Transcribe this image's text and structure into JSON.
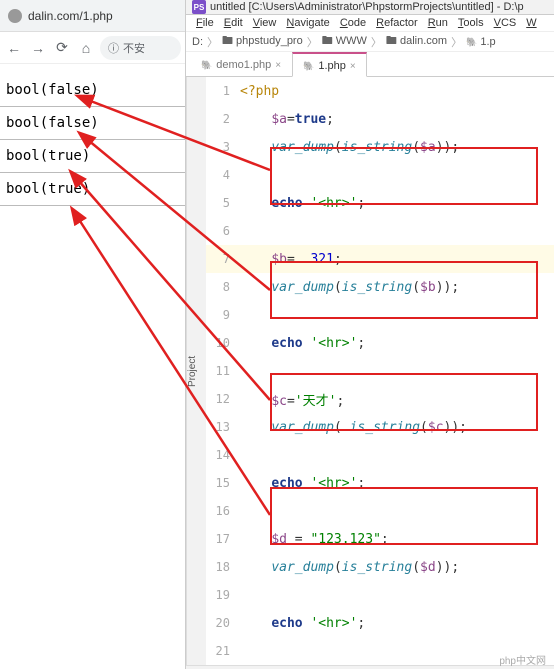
{
  "browser": {
    "tab_title": "dalin.com/1.php",
    "security_text": "不安",
    "output": [
      "bool(false)",
      "bool(false)",
      "bool(true)",
      "bool(true)"
    ]
  },
  "ide": {
    "title_text": "untitled [C:\\Users\\Administrator\\PhpstormProjects\\untitled] - D:\\p",
    "menu": [
      "File",
      "Edit",
      "View",
      "Navigate",
      "Code",
      "Refactor",
      "Run",
      "Tools",
      "VCS",
      "W"
    ],
    "breadcrumb": [
      "D:",
      "phpstudy_pro",
      "WWW",
      "dalin.com",
      "1.p"
    ],
    "tabs": [
      {
        "label": "demo1.php",
        "active": false
      },
      {
        "label": "1.php",
        "active": true
      }
    ],
    "project_label": "Project",
    "code_lines": [
      {
        "n": 1,
        "t": "php_open",
        "text": "<?php"
      },
      {
        "n": 2,
        "t": "assign_kw",
        "var": "$a",
        "op": "=",
        "kw": "true",
        "end": ";"
      },
      {
        "n": 3,
        "t": "dump",
        "func": "var_dump",
        "inner": "is_string",
        "arg": "$a"
      },
      {
        "n": 4,
        "t": "blank"
      },
      {
        "n": 5,
        "t": "echo",
        "str": "'<hr>'"
      },
      {
        "n": 6,
        "t": "blank"
      },
      {
        "n": 7,
        "t": "assign_num",
        "var": "$b",
        "op": "= ",
        "val": "321"
      },
      {
        "n": 8,
        "t": "dump",
        "func": "var_dump",
        "inner": "is_string",
        "arg": "$b"
      },
      {
        "n": 9,
        "t": "blank"
      },
      {
        "n": 10,
        "t": "echo",
        "str": "'<hr>'"
      },
      {
        "n": 11,
        "t": "blank"
      },
      {
        "n": 12,
        "t": "assign_str",
        "var": "$c",
        "op": "=",
        "val": "'天才'"
      },
      {
        "n": 13,
        "t": "dump",
        "func": "var_dump",
        "inner": "is_string",
        "arg": "$c",
        "sp": " "
      },
      {
        "n": 14,
        "t": "blank"
      },
      {
        "n": 15,
        "t": "echo",
        "str": "'<hr>'"
      },
      {
        "n": 16,
        "t": "blank"
      },
      {
        "n": 17,
        "t": "assign_str",
        "var": "$d",
        "op": " = ",
        "val": "\"123.123\""
      },
      {
        "n": 18,
        "t": "dump",
        "func": "var_dump",
        "inner": "is_string",
        "arg": "$d"
      },
      {
        "n": 19,
        "t": "blank"
      },
      {
        "n": 20,
        "t": "echo",
        "str": "'<hr>'"
      },
      {
        "n": 21,
        "t": "blank"
      }
    ],
    "current_line": 7
  },
  "watermark": "php中文网"
}
